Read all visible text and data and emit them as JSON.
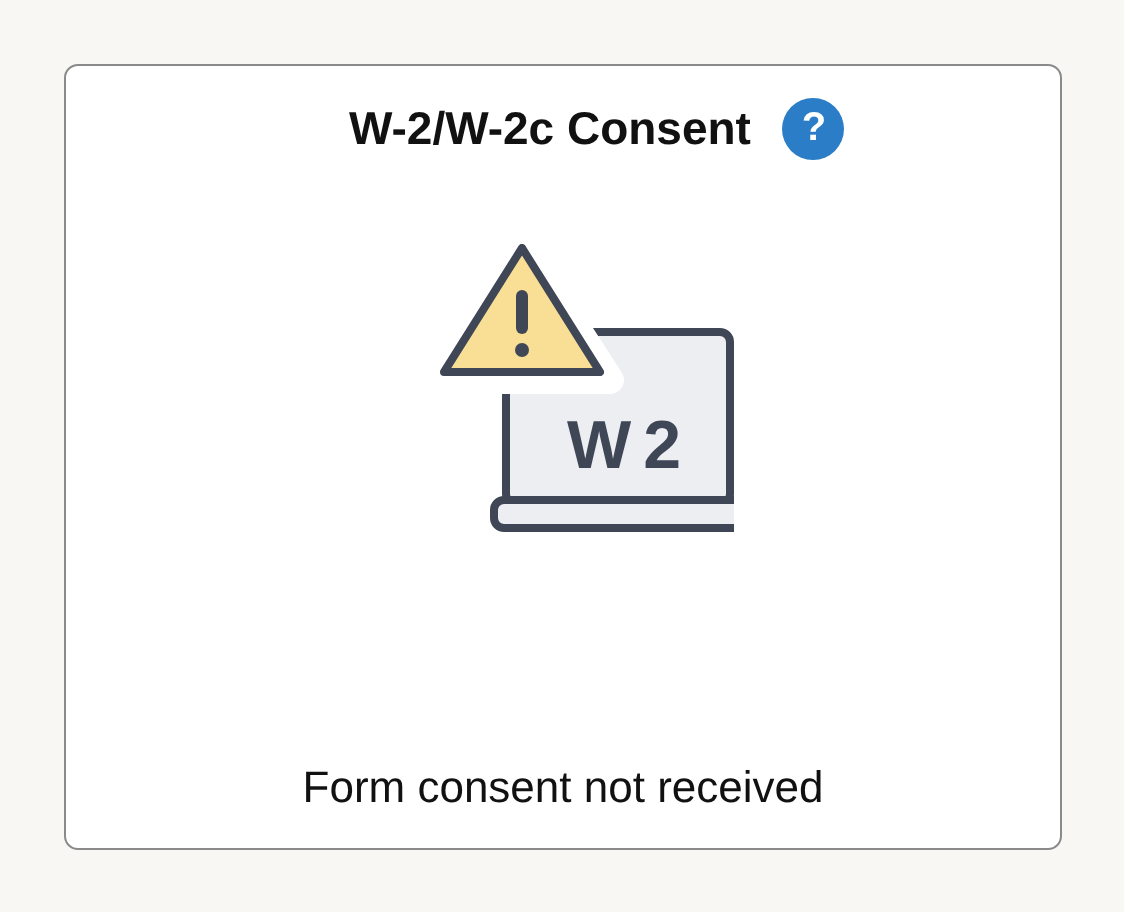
{
  "card": {
    "title": "W-2/W-2c Consent",
    "help": "?",
    "screen_label": "W2",
    "status": "Form consent not received"
  }
}
